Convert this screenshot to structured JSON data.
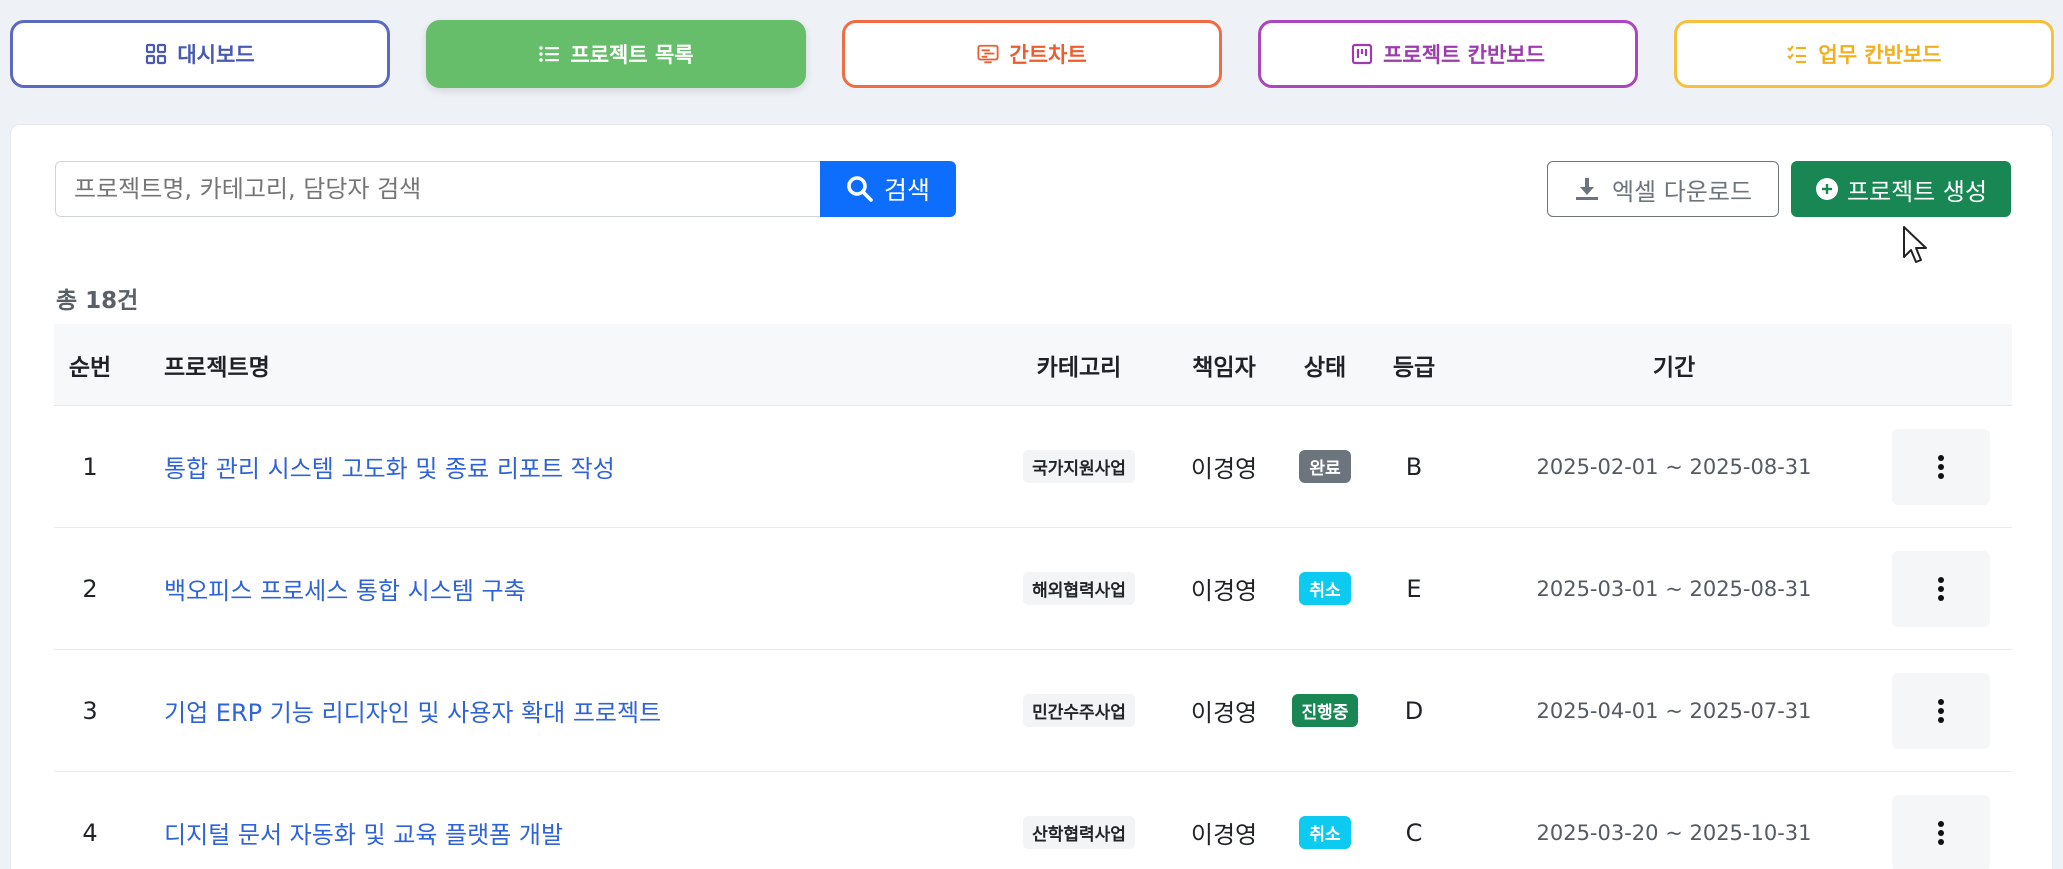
{
  "nav": {
    "dashboard": "대시보드",
    "project_list": "프로젝트 목록",
    "gantt": "간트차트",
    "project_kanban": "프로젝트 칸반보드",
    "work_kanban": "업무 칸반보드"
  },
  "toolbar": {
    "search_placeholder": "프로젝트명, 카테고리, 담당자 검색",
    "search_label": "검색",
    "excel_label": "엑셀 다운로드",
    "create_label": "프로젝트 생성"
  },
  "total_label": "총 18건",
  "table": {
    "headers": {
      "no": "순번",
      "name": "프로젝트명",
      "category": "카테고리",
      "owner": "책임자",
      "status": "상태",
      "grade": "등급",
      "period": "기간"
    },
    "rows": [
      {
        "no": "1",
        "name": "통합 관리 시스템 고도화 및 종료 리포트 작성",
        "category": "국가지원사업",
        "owner": "이경영",
        "status": "완료",
        "status_color": "#6c757d",
        "grade": "B",
        "period": "2025-02-01 ~ 2025-08-31"
      },
      {
        "no": "2",
        "name": "백오피스 프로세스 통합 시스템 구축",
        "category": "해외협력사업",
        "owner": "이경영",
        "status": "취소",
        "status_color": "#0dcaf0",
        "grade": "E",
        "period": "2025-03-01 ~ 2025-08-31"
      },
      {
        "no": "3",
        "name": "기업 ERP 기능 리디자인 및 사용자 확대 프로젝트",
        "category": "민간수주사업",
        "owner": "이경영",
        "status": "진행중",
        "status_color": "#198754",
        "grade": "D",
        "period": "2025-04-01 ~ 2025-07-31"
      },
      {
        "no": "4",
        "name": "디지털 문서 자동화 및 교육 플랫폼 개발",
        "category": "산학협력사업",
        "owner": "이경영",
        "status": "취소",
        "status_color": "#0dcaf0",
        "grade": "C",
        "period": "2025-03-20 ~ 2025-10-31"
      }
    ]
  },
  "icons": {
    "dashboard": "grid-icon",
    "list": "list-icon",
    "gantt": "gantt-icon",
    "kanban": "kanban-icon",
    "tasks": "checklist-icon",
    "search": "search-icon",
    "download": "download-icon",
    "plus": "plus-circle-icon",
    "more": "kebab-icon"
  }
}
